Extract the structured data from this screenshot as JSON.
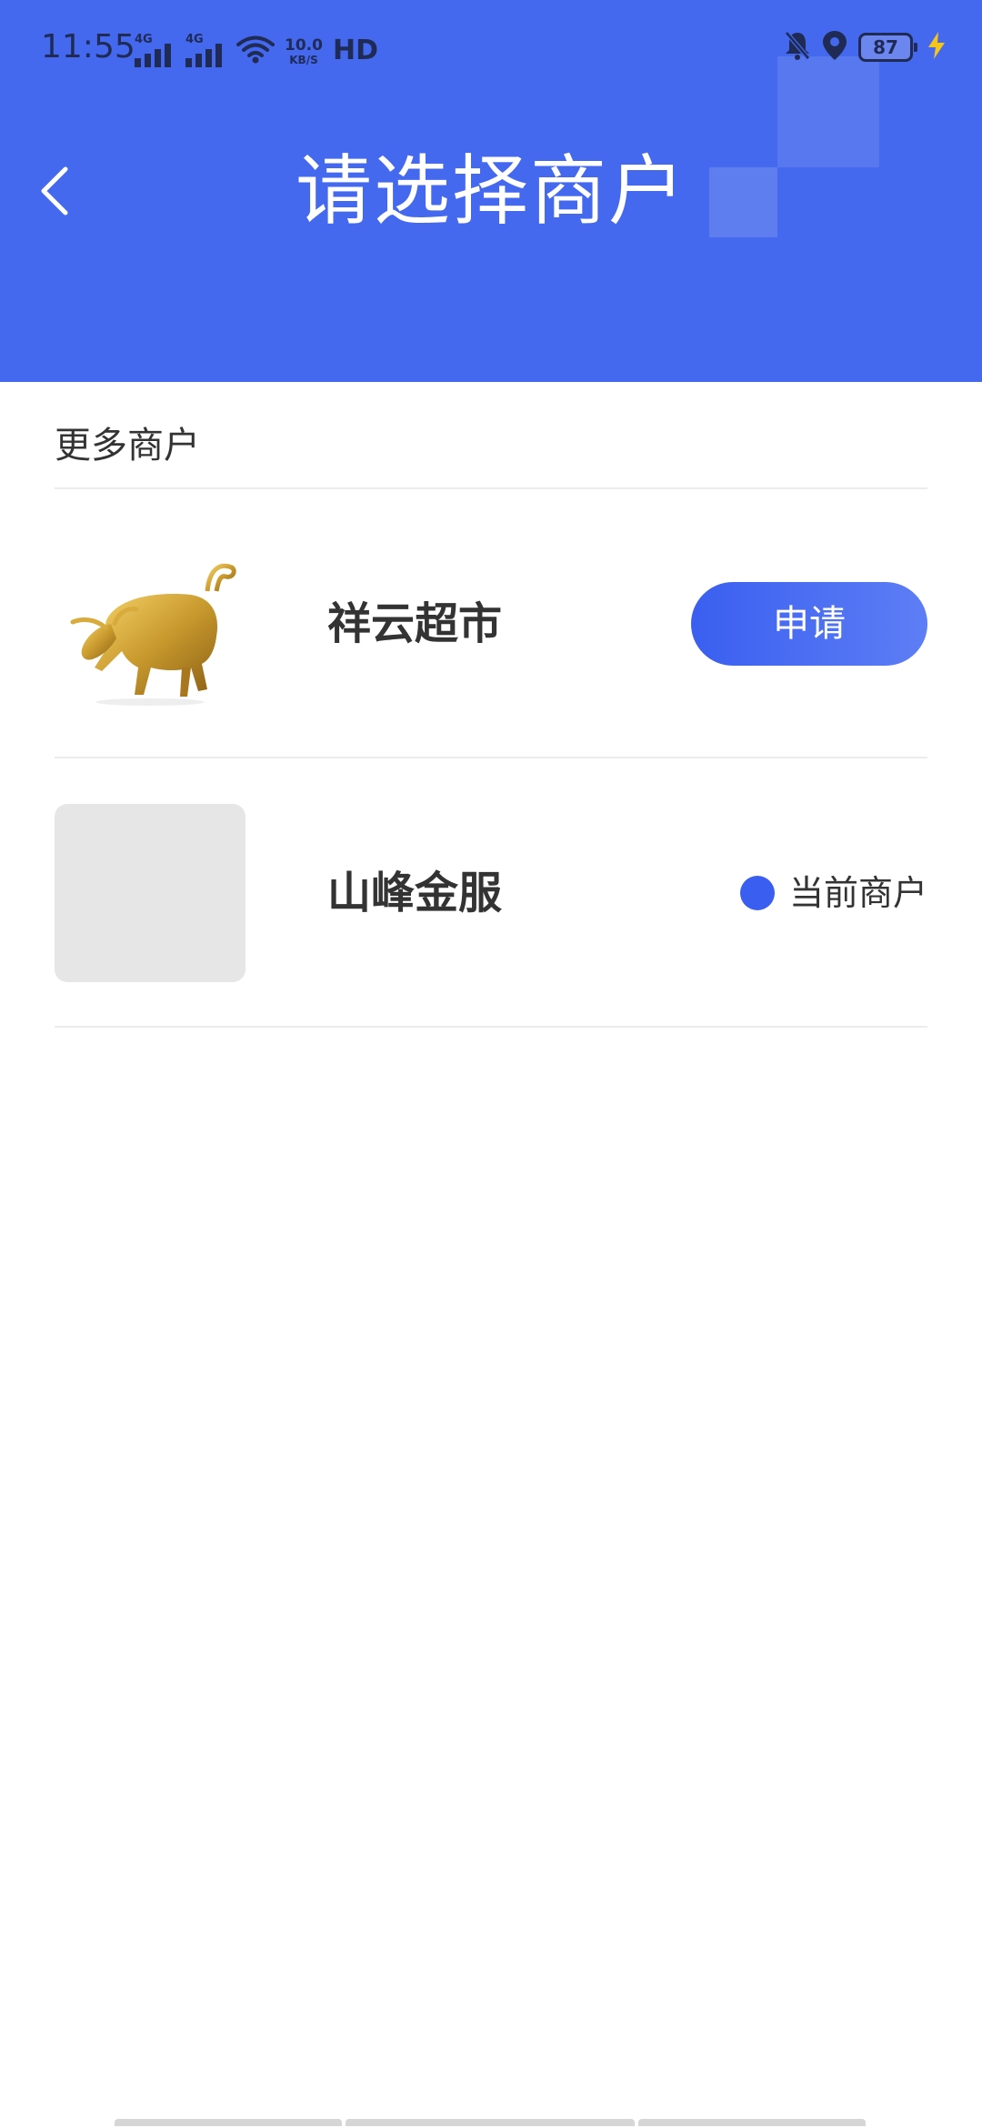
{
  "status_bar": {
    "time": "11:55",
    "signal_1_tag": "4G",
    "signal_2_tag": "4G",
    "net_speed_value": "10.0",
    "net_speed_unit": "KB/S",
    "hd_label": "HD",
    "battery_level": "87",
    "icons": [
      "signal-icon",
      "signal-icon",
      "wifi-icon",
      "mute-bell-icon",
      "location-icon",
      "battery-icon",
      "charging-bolt-icon"
    ]
  },
  "header": {
    "title": "请选择商户",
    "background_color": "#4469ee",
    "back_icon": "chevron-left-icon"
  },
  "section": {
    "title": "更多商户"
  },
  "merchants": [
    {
      "name": "祥云超市",
      "thumbnail": "golden-bull-image",
      "action_label": "申请"
    },
    {
      "name": "山峰金服",
      "thumbnail": "placeholder-image",
      "status_label": "当前商户"
    }
  ],
  "colors": {
    "accent": "#3a5ff0",
    "text_primary": "#333333",
    "divider": "#ececec",
    "placeholder": "#e6e6e6"
  }
}
